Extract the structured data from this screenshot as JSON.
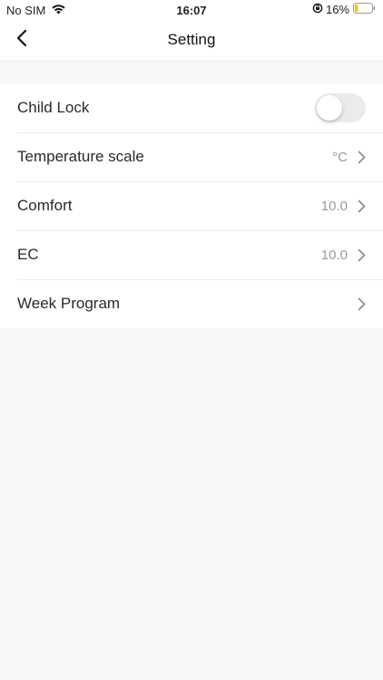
{
  "status_bar": {
    "carrier": "No SIM",
    "time": "16:07",
    "battery_percent": "16%"
  },
  "nav": {
    "title": "Setting"
  },
  "settings": {
    "items": [
      {
        "label": "Child Lock",
        "control": "toggle",
        "on": false
      },
      {
        "label": "Temperature scale",
        "value": "°C"
      },
      {
        "label": "Comfort",
        "value": "10.0"
      },
      {
        "label": "EC",
        "value": "10.0"
      },
      {
        "label": "Week Program",
        "value": ""
      }
    ]
  },
  "colors": {
    "background": "#f7f7f7",
    "surface": "#ffffff",
    "toggle_off": "#ebebeb",
    "battery_low": "#f2c300"
  }
}
